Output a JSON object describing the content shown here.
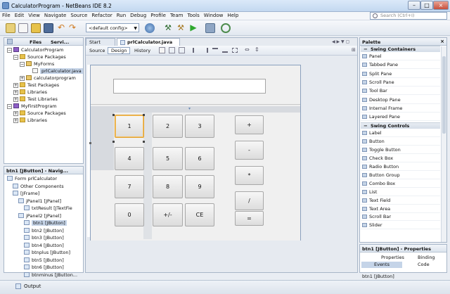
{
  "window": {
    "title": "CalculatorProgram - NetBeans IDE 8.2"
  },
  "menu": [
    "File",
    "Edit",
    "View",
    "Navigate",
    "Source",
    "Refactor",
    "Run",
    "Debug",
    "Profile",
    "Team",
    "Tools",
    "Window",
    "Help"
  ],
  "search": {
    "placeholder": "Search (Ctrl+I)"
  },
  "toolbar": {
    "config": "<default config>"
  },
  "projects_panel": {
    "tabs": [
      "Files",
      "Servi..."
    ],
    "rows": [
      {
        "label": "CalculatorProgram",
        "kind": "proj",
        "indent": 0,
        "exp": "−"
      },
      {
        "label": "Source Packages",
        "kind": "fold",
        "indent": 1,
        "exp": "−"
      },
      {
        "label": "MyForms",
        "kind": "pkg",
        "indent": 2,
        "exp": "−"
      },
      {
        "label": "prlCalculator.java",
        "kind": "java",
        "indent": 3,
        "exp": ""
      },
      {
        "label": "calculatorprogram",
        "kind": "pkg",
        "indent": 2,
        "exp": "+"
      },
      {
        "label": "Test Packages",
        "kind": "fold",
        "indent": 1,
        "exp": "+"
      },
      {
        "label": "Libraries",
        "kind": "fold",
        "indent": 1,
        "exp": "+"
      },
      {
        "label": "Test Libraries",
        "kind": "fold",
        "indent": 1,
        "exp": "+"
      },
      {
        "label": "MyFirstProgram",
        "kind": "proj",
        "indent": 0,
        "exp": "−"
      },
      {
        "label": "Source Packages",
        "kind": "fold",
        "indent": 1,
        "exp": "+"
      },
      {
        "label": "Libraries",
        "kind": "fold",
        "indent": 1,
        "exp": "+"
      }
    ]
  },
  "navigator": {
    "title": "btn1 [JButton] - Navig...",
    "rows": [
      {
        "label": "Form prlCalculator",
        "indent": 0
      },
      {
        "label": "Other Components",
        "indent": 1
      },
      {
        "label": "[JFrame]",
        "indent": 1
      },
      {
        "label": "jPanel1 [JPanel]",
        "indent": 2
      },
      {
        "label": "txtResult [JTextFie",
        "indent": 3
      },
      {
        "label": "jPanel2 [JPanel]",
        "indent": 2
      },
      {
        "label": "btn1 [JButton]",
        "indent": 3
      },
      {
        "label": "btn2 [JButton]",
        "indent": 3
      },
      {
        "label": "btn3 [JButton]",
        "indent": 3
      },
      {
        "label": "btn4 [JButton]",
        "indent": 3
      },
      {
        "label": "btnplus [JButton]",
        "indent": 3
      },
      {
        "label": "btn5 [JButton]",
        "indent": 3
      },
      {
        "label": "btn6 [JButton]",
        "indent": 3
      },
      {
        "label": "btnminus [JButton...",
        "indent": 3
      }
    ]
  },
  "editor": {
    "tabs": [
      "Start Page",
      "prlCalculator.java"
    ],
    "modes": [
      "Source",
      "Design",
      "History"
    ]
  },
  "calculator": {
    "grid": [
      [
        "1",
        "2",
        "3"
      ],
      [
        "4",
        "5",
        "6"
      ],
      [
        "7",
        "8",
        "9"
      ],
      [
        "0",
        "+/-",
        "CE"
      ]
    ],
    "ops": [
      "+",
      "-",
      "*",
      "/",
      "="
    ]
  },
  "palette": {
    "title": "Palette",
    "sections": [
      {
        "name": "Swing Containers",
        "items": [
          "Panel",
          "Tabbed Pane",
          "Split Pane",
          "Scroll Pane",
          "Tool Bar",
          "Desktop Pane",
          "Internal Frame",
          "Layered Pane"
        ]
      },
      {
        "name": "Swing Controls",
        "items": [
          "Label",
          "Button",
          "Toggle Button",
          "Check Box",
          "Radio Button",
          "Button Group",
          "Combo Box",
          "List",
          "Text Field",
          "Text Area",
          "Scroll Bar",
          "Slider"
        ]
      }
    ]
  },
  "properties": {
    "title": "btn1 [JButton] - Properties",
    "tabs": [
      "Properties",
      "Binding",
      "Events",
      "Code"
    ],
    "footer": "btn1 [JButton]"
  },
  "status": {
    "output": "Output"
  }
}
